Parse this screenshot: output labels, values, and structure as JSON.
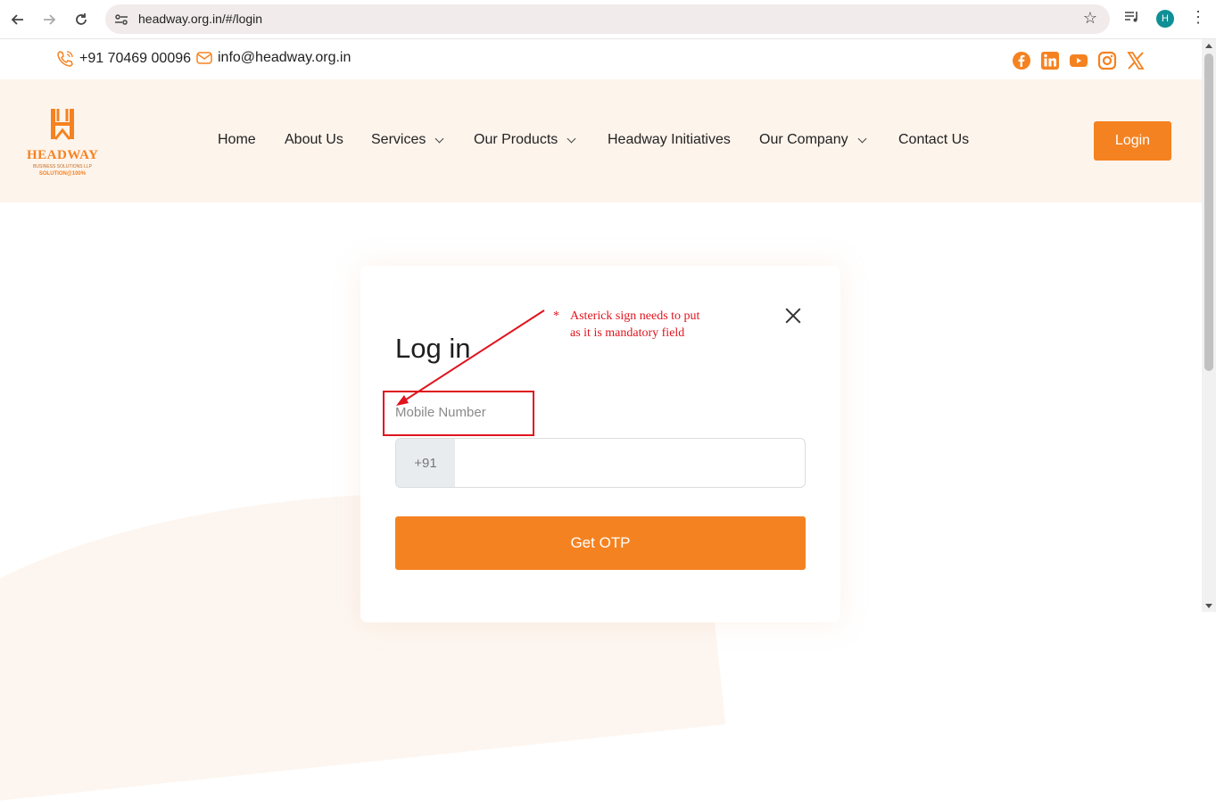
{
  "browser": {
    "url": "headway.org.in/#/login",
    "avatar_letter": "H"
  },
  "contact": {
    "phone": "+91 70469 00096",
    "email": "info@headway.org.in"
  },
  "social_icons": [
    "facebook-icon",
    "linkedin-icon",
    "youtube-icon",
    "instagram-icon",
    "x-icon"
  ],
  "brand": {
    "name": "HEADWAY",
    "subtitle": "BUSINESS SOLUTIONS LLP",
    "tagline": "SOLUTION@100%",
    "accent_color": "#f58220"
  },
  "nav": {
    "home": "Home",
    "about": "About Us",
    "services": "Services",
    "products": "Our Products",
    "initiatives": "Headway Initiatives",
    "company": "Our Company",
    "contact": "Contact Us",
    "login": "Login"
  },
  "login_form": {
    "title": "Log in",
    "field_label": "Mobile Number",
    "country_code": "+91",
    "phone_value": "",
    "submit_label": "Get OTP"
  },
  "annotation": {
    "marker": "*",
    "line1": "Asterick sign needs to put",
    "line2": "as it is mandatory field",
    "color": "#e0141e"
  }
}
